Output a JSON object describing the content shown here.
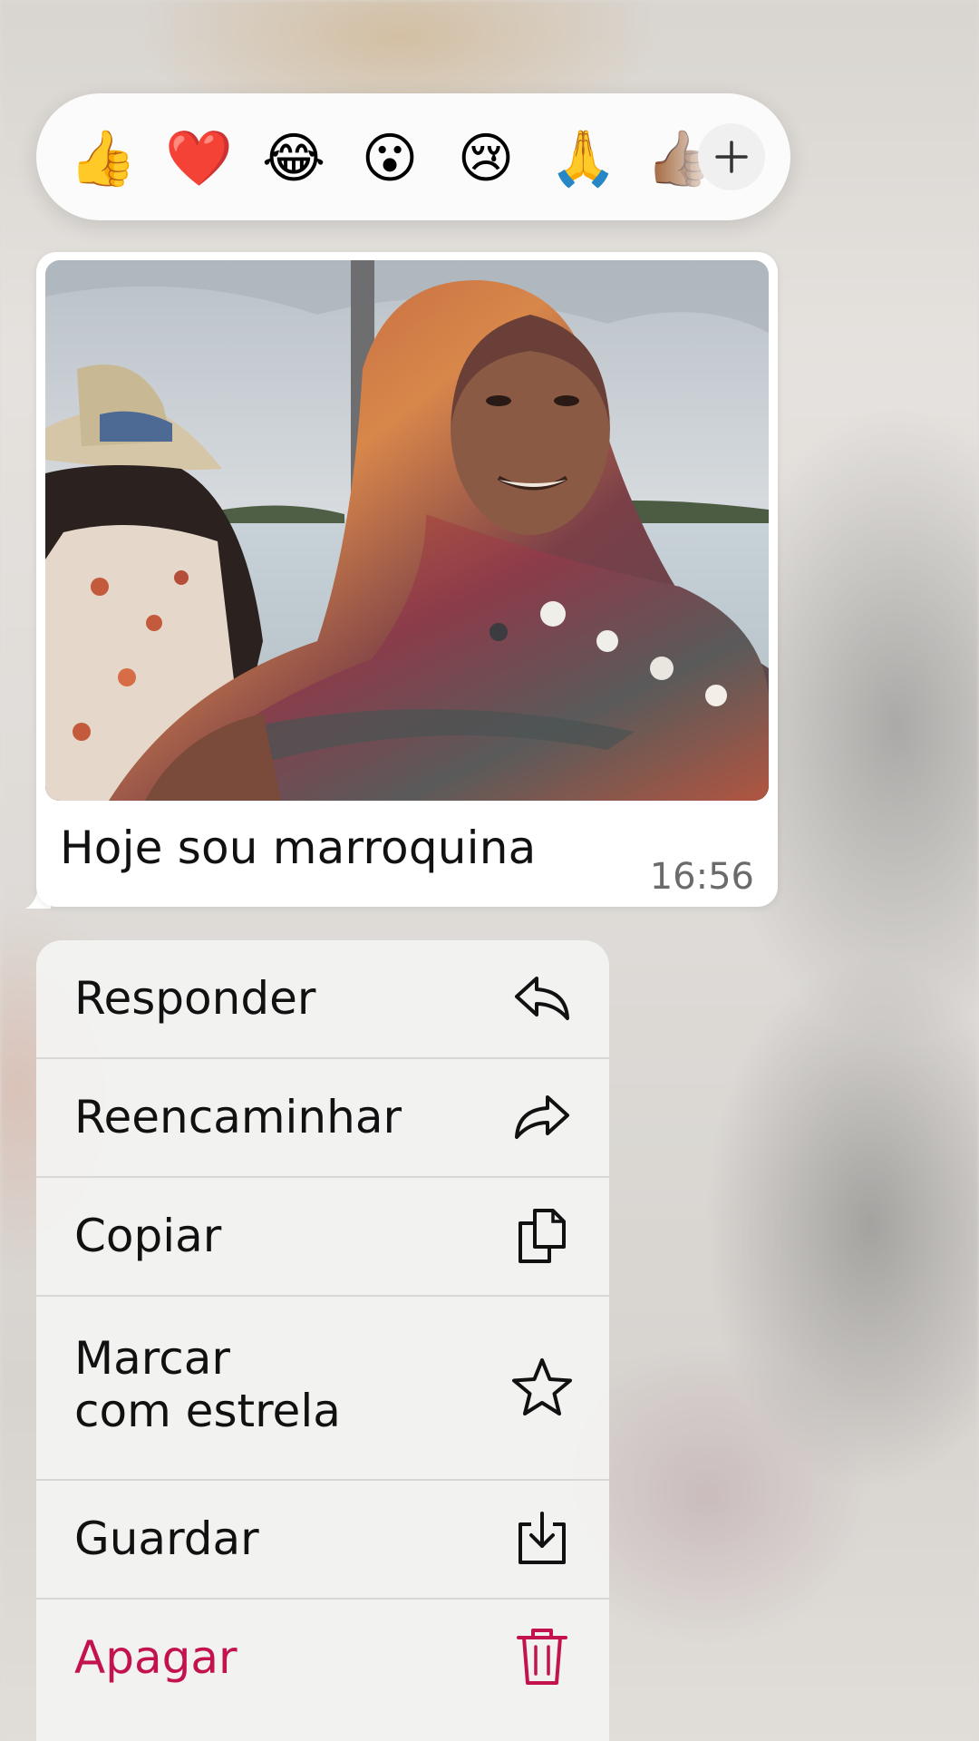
{
  "reactions": {
    "emojis": [
      {
        "name": "thumbs-up",
        "glyph": "👍"
      },
      {
        "name": "red-heart",
        "glyph": "❤️"
      },
      {
        "name": "tears-of-joy",
        "glyph": "😂"
      },
      {
        "name": "surprised-face",
        "glyph": "😮"
      },
      {
        "name": "crying-face",
        "glyph": "😢"
      },
      {
        "name": "folded-hands",
        "glyph": "🙏"
      },
      {
        "name": "thumbs-up-dark-skin",
        "glyph": "👍🏾"
      }
    ],
    "more_icon": "plus-icon"
  },
  "message": {
    "caption": "Hoje sou marroquina",
    "time": "16:56",
    "image": "photo-woman-with-headscarf-by-water"
  },
  "menu": {
    "items": [
      {
        "label": "Responder",
        "icon": "reply-icon"
      },
      {
        "label": "Reencaminhar",
        "icon": "forward-icon"
      },
      {
        "label": "Copiar",
        "icon": "copy-icon"
      },
      {
        "label_line1": "Marcar",
        "label_line2": "com estrela",
        "icon": "star-icon"
      },
      {
        "label": "Guardar",
        "icon": "download-icon"
      },
      {
        "label": "Apagar",
        "icon": "trash-icon",
        "color": "#c3134f"
      }
    ]
  },
  "colors": {
    "danger": "#c3134f",
    "bubble": "#ffffff",
    "menu_bg": "#f3f2f1"
  }
}
